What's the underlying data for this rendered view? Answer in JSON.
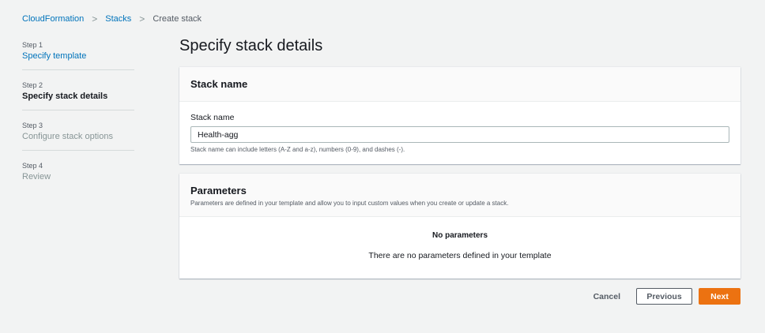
{
  "breadcrumb": {
    "items": [
      "CloudFormation",
      "Stacks"
    ],
    "current": "Create stack"
  },
  "steps": [
    {
      "num": "Step 1",
      "title": "Specify template"
    },
    {
      "num": "Step 2",
      "title": "Specify stack details"
    },
    {
      "num": "Step 3",
      "title": "Configure stack options"
    },
    {
      "num": "Step 4",
      "title": "Review"
    }
  ],
  "page_title": "Specify stack details",
  "stack_name": {
    "header": "Stack name",
    "label": "Stack name",
    "value": "Health-agg",
    "hint": "Stack name can include letters (A-Z and a-z), numbers (0-9), and dashes (-)."
  },
  "parameters": {
    "header": "Parameters",
    "description": "Parameters are defined in your template and allow you to input custom values when you create or update a stack.",
    "empty_title": "No parameters",
    "empty_text": "There are no parameters defined in your template"
  },
  "actions": {
    "cancel": "Cancel",
    "previous": "Previous",
    "next": "Next"
  }
}
